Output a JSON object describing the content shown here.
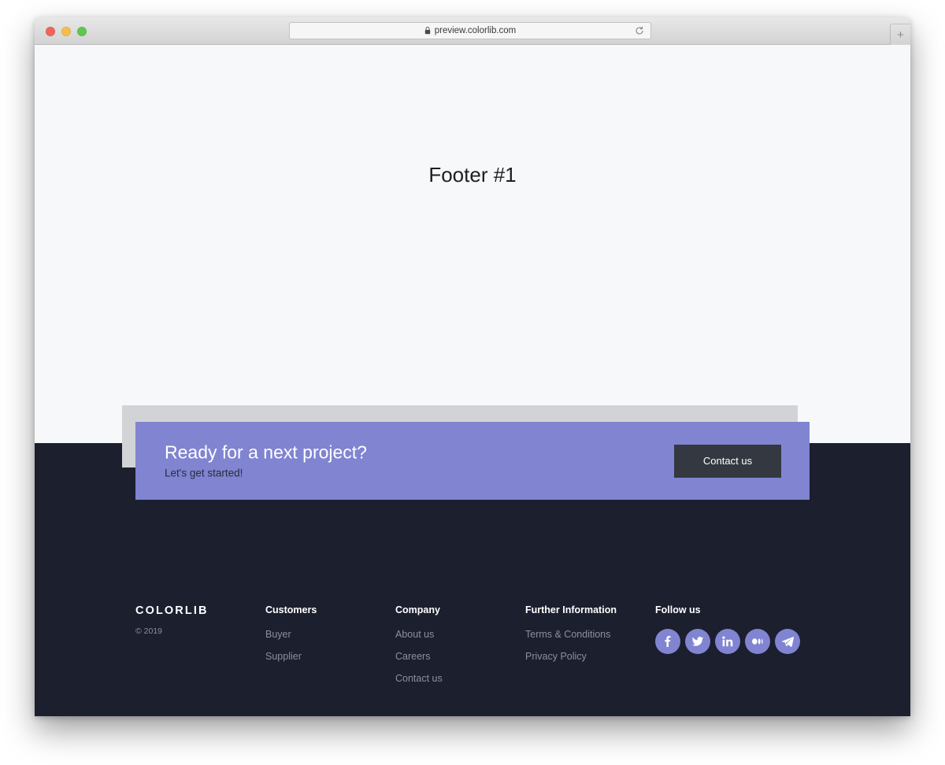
{
  "browser": {
    "url": "preview.colorlib.com",
    "lock_icon": "lock-icon",
    "reload_icon": "reload-icon",
    "new_tab_label": "+",
    "traffic_lights": [
      "close",
      "minimize",
      "maximize"
    ]
  },
  "page": {
    "title": "Footer #1",
    "background": "#f7f8fa"
  },
  "cta": {
    "heading": "Ready for a next project?",
    "subheading": "Let's get started!",
    "button_label": "Contact us",
    "banner_color": "#8084d1",
    "button_color": "#343840",
    "plate_color": "#d2d3d6"
  },
  "footer": {
    "background": "#1b1f2e",
    "brand": {
      "logo": "COLORLIB",
      "copyright": "© 2019"
    },
    "columns": [
      {
        "title": "Customers",
        "links": [
          "Buyer",
          "Supplier"
        ]
      },
      {
        "title": "Company",
        "links": [
          "About us",
          "Careers",
          "Contact us"
        ]
      },
      {
        "title": "Further Information",
        "links": [
          "Terms & Conditions",
          "Privacy Policy"
        ]
      }
    ],
    "social": {
      "title": "Follow us",
      "accent_color": "#8084d1",
      "items": [
        {
          "name": "facebook-icon"
        },
        {
          "name": "twitter-icon"
        },
        {
          "name": "linkedin-icon"
        },
        {
          "name": "medium-icon"
        },
        {
          "name": "telegram-icon"
        }
      ]
    }
  }
}
